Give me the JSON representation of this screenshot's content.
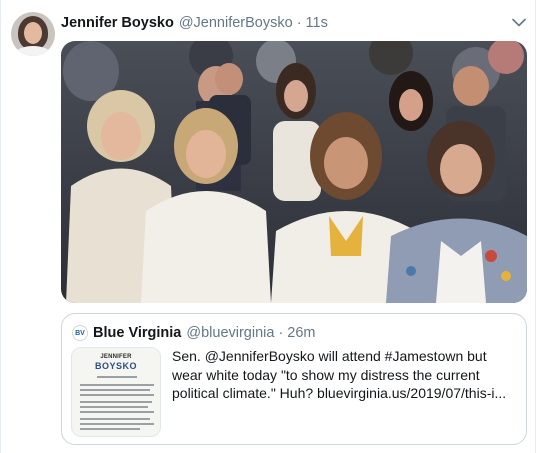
{
  "tweet": {
    "author_name": "Jennifer Boysko",
    "author_handle": "@JenniferBoysko",
    "separator": "·",
    "timestamp": "11s",
    "avatar_icon": "user-avatar",
    "menu_icon": "chevron-down-icon",
    "photo_description_icon": "group-photo"
  },
  "quoted_tweet": {
    "author_name": "Blue Virginia",
    "author_handle": "@bluevirginia",
    "separator": "·",
    "timestamp": "26m",
    "avatar_label": "BV",
    "thumbnail_heading": "JENNIFER",
    "thumbnail_title": "BOYSKO",
    "text": "Sen. @JenniferBoysko will attend #Jamestown but wear white today \"to show my distress the current political climate.\" Huh? bluevirginia.us/2019/07/this-i..."
  },
  "colors": {
    "text_primary": "#14171a",
    "text_secondary": "#657786",
    "border": "#ccd6dd",
    "icon": "#657786"
  }
}
